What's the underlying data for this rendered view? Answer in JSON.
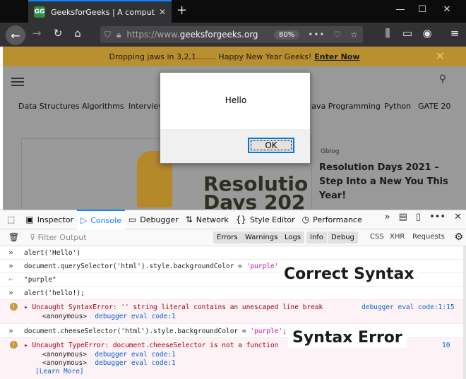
{
  "browser": {
    "tab_title": "GeeksforGeeks | A computer sc",
    "tab_favicon": "GG",
    "url_prefix": "https://www.",
    "url_domain": "geeksforgeeks.org",
    "zoom": "80%",
    "url_more": "•••"
  },
  "page": {
    "banner_text": "Dropping jaws in 3,2,1........ Happy New Year Geeks!",
    "banner_link": "Enter Now",
    "topics": [
      "Data Structures",
      "Algorithms",
      "Interview",
      "Java Programming",
      "Python",
      "GATE 20"
    ],
    "hero_text_1": "Resolutio",
    "hero_text_2": "Days 202",
    "blog_tag": "Gblog",
    "blog_title": "Resolution Days 2021 – Step Into a New You This Year!"
  },
  "alert": {
    "message": "Hello",
    "ok_label": "OK"
  },
  "devtools": {
    "tabs": [
      {
        "label": "Inspector",
        "icon": "inspector-icon"
      },
      {
        "label": "Console",
        "icon": "console-icon"
      },
      {
        "label": "Debugger",
        "icon": "debugger-icon"
      },
      {
        "label": "Network",
        "icon": "network-icon"
      },
      {
        "label": "Style Editor",
        "icon": "style-editor-icon"
      },
      {
        "label": "Performance",
        "icon": "performance-icon"
      }
    ],
    "filter_placeholder": "Filter Output",
    "filters": [
      "Errors",
      "Warnings",
      "Logs",
      "Info",
      "Debug"
    ],
    "extra_filters": [
      "CSS",
      "XHR",
      "Requests"
    ]
  },
  "console": {
    "line1": "alert('Hello')",
    "line2_a": "document.",
    "line2_b": "querySelector('html').style.backgroundColor = ",
    "line2_str": "'purple'",
    "line2_end": ";",
    "result": "\"purple\"",
    "line3": "alert('hello!);",
    "error1": "Uncaught SyntaxError: '' string literal contains an unescaped line break",
    "error1_loc": "debugger eval code:1:15",
    "error1_frame": "<anonymous>",
    "error1_frame_loc": "debugger eval code:1",
    "line4_a": "document.",
    "line4_b": "cheeseSelector('html').style.backgroundColor = ",
    "line4_str": "'purple'",
    "line4_end": ";",
    "error2": "Uncaught TypeError: document.cheeseSelector is not a function",
    "error2_loc": "10",
    "error2_frame": "<anonymous>",
    "error2_frame_loc": "debugger eval code:1",
    "error2_frame2": "<anonymous>",
    "error2_frame2_loc": "debugger eval code:1",
    "learn_more": "[Learn More]"
  },
  "annotations": {
    "correct": "Correct Syntax",
    "error": "Syntax Error"
  }
}
